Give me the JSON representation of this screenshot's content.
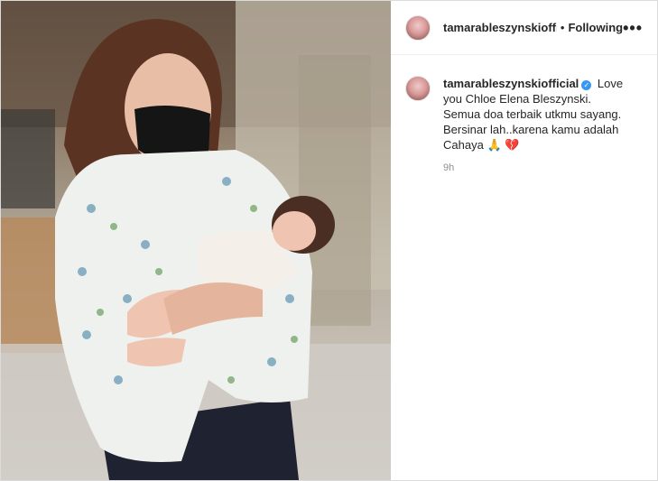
{
  "header": {
    "username": "tamarableszynskiofficial",
    "separator": "•",
    "follow_label": "Following",
    "more_label": "•••"
  },
  "caption": {
    "username": "tamarableszynskiofficial",
    "text": "Love you Chloe Elena Bleszynski. Semua doa terbaik utkmu sayang. Bersinar lah..karena kamu adalah Cahaya",
    "emoji_pray": "🙏",
    "emoji_heart": "💔",
    "time": "9h"
  },
  "colors": {
    "verified": "#3897f0",
    "muted": "#8e8e8e",
    "text": "#262626"
  }
}
